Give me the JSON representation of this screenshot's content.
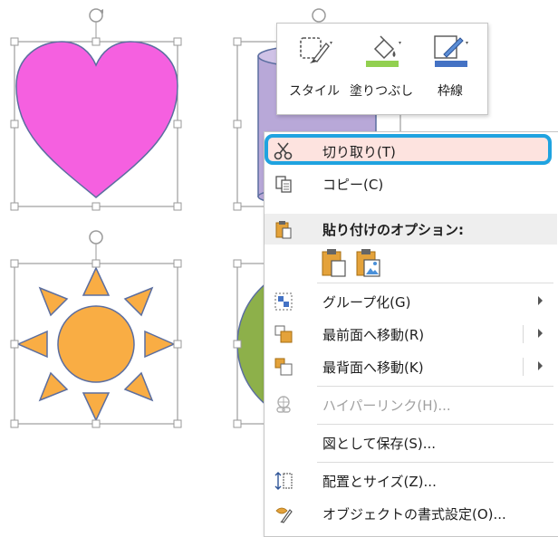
{
  "mini_toolbar": {
    "buttons": [
      {
        "label": "スタイル",
        "icon": "shape-style-icon"
      },
      {
        "label": "塗りつぶし",
        "icon": "paint-bucket-icon"
      },
      {
        "label": "枠線",
        "icon": "pen-outline-icon"
      }
    ],
    "colors": {
      "fill": "#92d050",
      "outline": "#4472c4"
    }
  },
  "context_menu": {
    "items": [
      {
        "label": "切り取り(T)",
        "icon": "scissors-icon",
        "highlighted": true
      },
      {
        "label": "コピー(C)",
        "icon": "copy-icon"
      },
      {
        "label": "貼り付けのオプション:",
        "icon": "paste-icon",
        "header": true
      },
      {
        "label": "グループ化(G)",
        "icon": "group-icon",
        "submenu": true
      },
      {
        "label": "最前面へ移動(R)",
        "icon": "bring-to-front-icon",
        "submenu": true
      },
      {
        "label": "最背面へ移動(K)",
        "icon": "send-to-back-icon",
        "submenu": true
      },
      {
        "label": "ハイパーリンク(H)...",
        "icon": "hyperlink-icon",
        "disabled": true
      },
      {
        "label": "図として保存(S)..."
      },
      {
        "label": "配置とサイズ(Z)...",
        "icon": "position-size-icon"
      },
      {
        "label": "オブジェクトの書式設定(O)...",
        "icon": "format-object-icon"
      }
    ],
    "paste_options": [
      "paste-keep-icon",
      "paste-picture-icon"
    ],
    "highlight_ring_color": "#1fa3e0"
  },
  "shapes": [
    {
      "name": "heart",
      "fill": "#f560e0"
    },
    {
      "name": "cylinder",
      "fill": "#b8a8d8"
    },
    {
      "name": "sun",
      "fill": "#f9ad44"
    },
    {
      "name": "circle",
      "fill": "#8db04a"
    }
  ]
}
